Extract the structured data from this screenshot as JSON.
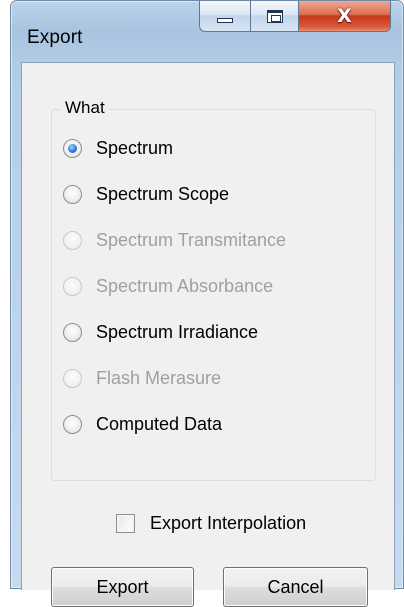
{
  "window": {
    "title": "Export",
    "caption": {
      "minimize_icon": "minimize-icon",
      "maximize_icon": "maximize-icon",
      "close_glyph": "X"
    }
  },
  "group": {
    "legend": "What",
    "options": [
      {
        "label": "Spectrum",
        "checked": true,
        "enabled": true
      },
      {
        "label": "Spectrum Scope",
        "checked": false,
        "enabled": true
      },
      {
        "label": "Spectrum Transmitance",
        "checked": false,
        "enabled": false
      },
      {
        "label": "Spectrum Absorbance",
        "checked": false,
        "enabled": false
      },
      {
        "label": "Spectrum Irradiance",
        "checked": false,
        "enabled": true
      },
      {
        "label": "Flash Merasure",
        "checked": false,
        "enabled": false
      },
      {
        "label": "Computed Data",
        "checked": false,
        "enabled": true
      }
    ]
  },
  "interpolation": {
    "label": "Export Interpolation",
    "checked": false
  },
  "buttons": {
    "export_label": "Export",
    "cancel_label": "Cancel"
  },
  "colors": {
    "frame": "#a9c4e1",
    "close_button": "#c8381b",
    "client_background": "#f0f0f0",
    "disabled_text": "#a0a0a0",
    "radio_dot": "#2a7fd4"
  }
}
